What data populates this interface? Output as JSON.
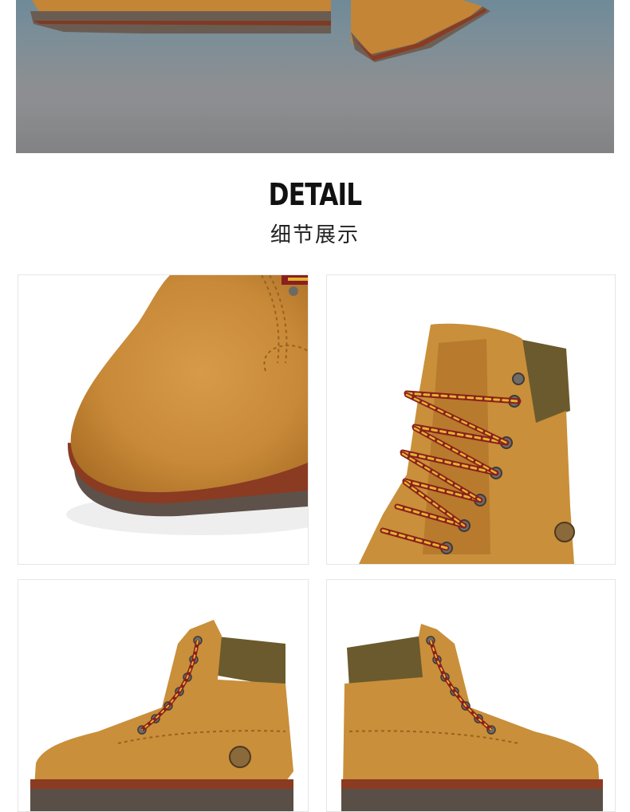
{
  "section": {
    "title_en": "DETAIL",
    "title_zh": "细节展示"
  },
  "colors": {
    "leather": "#c98f3a",
    "leather_dark": "#a96f25",
    "collar": "#6b5a2d",
    "sole": "#5a4f46",
    "welt": "#8a3b22",
    "lace_red": "#8b1f1f",
    "lace_yellow": "#e2b52c"
  }
}
